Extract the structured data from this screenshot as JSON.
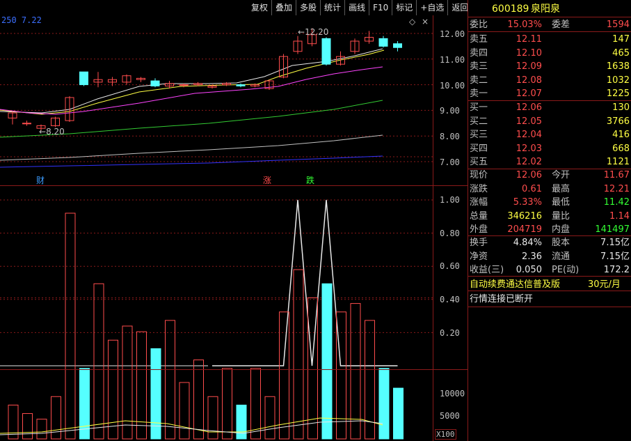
{
  "toolbar": [
    "复权",
    "叠加",
    "多股",
    "统计",
    "画线",
    "F10",
    "标记",
    "+自选",
    "返回"
  ],
  "ma_label": "250  7.22",
  "price_axis": [
    "12.00",
    "11.00",
    "10.00",
    "9.00",
    "8.00",
    "7.00"
  ],
  "indicator_axis": [
    "1.00",
    "0.80",
    "0.60",
    "0.40",
    "0.20"
  ],
  "volume_axis": [
    "10000",
    "5000"
  ],
  "volume_unit": "X100",
  "annotations": {
    "high": "12.20",
    "low": "8.20"
  },
  "event_markers": [
    "财",
    "涨",
    "跌"
  ],
  "stock": {
    "code": "600189",
    "name": "泉阳泉"
  },
  "weibi": {
    "label": "委比",
    "value": "15.03%",
    "label2": "委差",
    "value2": "1594"
  },
  "asks": [
    {
      "label": "卖五",
      "price": "12.11",
      "vol": "147"
    },
    {
      "label": "卖四",
      "price": "12.10",
      "vol": "465"
    },
    {
      "label": "卖三",
      "price": "12.09",
      "vol": "1638"
    },
    {
      "label": "卖二",
      "price": "12.08",
      "vol": "1032"
    },
    {
      "label": "卖一",
      "price": "12.07",
      "vol": "1225"
    }
  ],
  "bids": [
    {
      "label": "买一",
      "price": "12.06",
      "vol": "130"
    },
    {
      "label": "买二",
      "price": "12.05",
      "vol": "3766"
    },
    {
      "label": "买三",
      "price": "12.04",
      "vol": "416"
    },
    {
      "label": "买四",
      "price": "12.03",
      "vol": "668"
    },
    {
      "label": "买五",
      "price": "12.02",
      "vol": "1121"
    }
  ],
  "stats": [
    {
      "l1": "现价",
      "v1": "12.06",
      "c1": "red",
      "l2": "今开",
      "v2": "11.67",
      "c2": "red"
    },
    {
      "l1": "涨跌",
      "v1": "0.61",
      "c1": "red",
      "l2": "最高",
      "v2": "12.21",
      "c2": "red"
    },
    {
      "l1": "涨幅",
      "v1": "5.33%",
      "c1": "red",
      "l2": "最低",
      "v2": "11.42",
      "c2": "green"
    },
    {
      "l1": "总量",
      "v1": "346216",
      "c1": "yellow",
      "l2": "量比",
      "v2": "1.14",
      "c2": "red"
    },
    {
      "l1": "外盘",
      "v1": "204719",
      "c1": "red",
      "l2": "内盘",
      "v2": "141497",
      "c2": "green"
    }
  ],
  "stats2": [
    {
      "l1": "换手",
      "v1": "4.84%",
      "l2": "股本",
      "v2": "7.15亿"
    },
    {
      "l1": "净资",
      "v1": "2.36",
      "l2": "流通",
      "v2": "7.15亿"
    },
    {
      "l1": "收益(三)",
      "v1": "0.050",
      "l2": "PE(动)",
      "v2": "172.2"
    }
  ],
  "promo": {
    "text": "自动续费通达信普及版",
    "price": "30元/月"
  },
  "status_text": "行情连接已断开",
  "colors": {
    "up": "#ff4d4d",
    "down": "#55ffff",
    "bg": "#000000",
    "grid": "#8b1a1a"
  },
  "candles": [
    {
      "o": 8.7,
      "c": 8.9,
      "h": 8.95,
      "l": 8.45
    },
    {
      "o": 8.5,
      "c": 8.5,
      "h": 8.6,
      "l": 8.4
    },
    {
      "o": 8.3,
      "c": 8.4,
      "h": 8.45,
      "l": 8.2
    },
    {
      "o": 8.4,
      "c": 8.7,
      "h": 8.75,
      "l": 8.35
    },
    {
      "o": 8.6,
      "c": 9.5,
      "h": 9.55,
      "l": 8.55
    },
    {
      "o": 10.5,
      "c": 10.0,
      "h": 10.5,
      "l": 9.95
    },
    {
      "o": 10.1,
      "c": 10.2,
      "h": 10.5,
      "l": 9.9
    },
    {
      "o": 10.1,
      "c": 10.2,
      "h": 10.3,
      "l": 9.95
    },
    {
      "o": 10.1,
      "c": 10.35,
      "h": 10.4,
      "l": 10.0
    },
    {
      "o": 10.2,
      "c": 10.25,
      "h": 10.3,
      "l": 10.1
    },
    {
      "o": 10.15,
      "c": 9.95,
      "h": 10.25,
      "l": 9.9
    },
    {
      "o": 9.95,
      "c": 10.05,
      "h": 10.15,
      "l": 9.85
    },
    {
      "o": 10.0,
      "c": 10.0,
      "h": 10.05,
      "l": 9.9
    },
    {
      "o": 10.0,
      "c": 10.05,
      "h": 10.1,
      "l": 9.95
    },
    {
      "o": 9.9,
      "c": 9.95,
      "h": 10.0,
      "l": 9.85
    },
    {
      "o": 10.0,
      "c": 10.05,
      "h": 10.1,
      "l": 9.95
    },
    {
      "o": 10.0,
      "c": 9.95,
      "h": 10.05,
      "l": 9.9
    },
    {
      "o": 9.95,
      "c": 10.0,
      "h": 10.05,
      "l": 9.9
    },
    {
      "o": 9.85,
      "c": 10.15,
      "h": 10.2,
      "l": 9.8
    },
    {
      "o": 10.3,
      "c": 11.1,
      "h": 11.2,
      "l": 10.25
    },
    {
      "o": 11.3,
      "c": 11.7,
      "h": 11.9,
      "l": 11.2
    },
    {
      "o": 11.6,
      "c": 11.95,
      "h": 12.2,
      "l": 11.5
    },
    {
      "o": 11.8,
      "c": 10.8,
      "h": 11.85,
      "l": 10.75
    },
    {
      "o": 10.8,
      "c": 11.1,
      "h": 11.3,
      "l": 10.75
    },
    {
      "o": 11.3,
      "c": 11.7,
      "h": 11.8,
      "l": 11.2
    },
    {
      "o": 11.7,
      "c": 11.85,
      "h": 12.1,
      "l": 11.6
    },
    {
      "o": 11.8,
      "c": 11.5,
      "h": 11.9,
      "l": 11.45
    },
    {
      "o": 11.6,
      "c": 11.45,
      "h": 11.7,
      "l": 11.3
    }
  ],
  "volumes": [
    1200,
    900,
    700,
    1500,
    8000,
    2500,
    5500,
    3500,
    4000,
    3800,
    3200,
    4200,
    2000,
    2800,
    1500,
    2500,
    1200,
    2500,
    1500,
    4500,
    6000,
    5000,
    5500,
    4500,
    4800,
    4200,
    2500,
    1800
  ],
  "signal": [
    0,
    0,
    0,
    0,
    0,
    0,
    0,
    0,
    0,
    0,
    0,
    0,
    0,
    0,
    0,
    0,
    0,
    0,
    0,
    0,
    1,
    0,
    1,
    0,
    0,
    0,
    0,
    0
  ]
}
